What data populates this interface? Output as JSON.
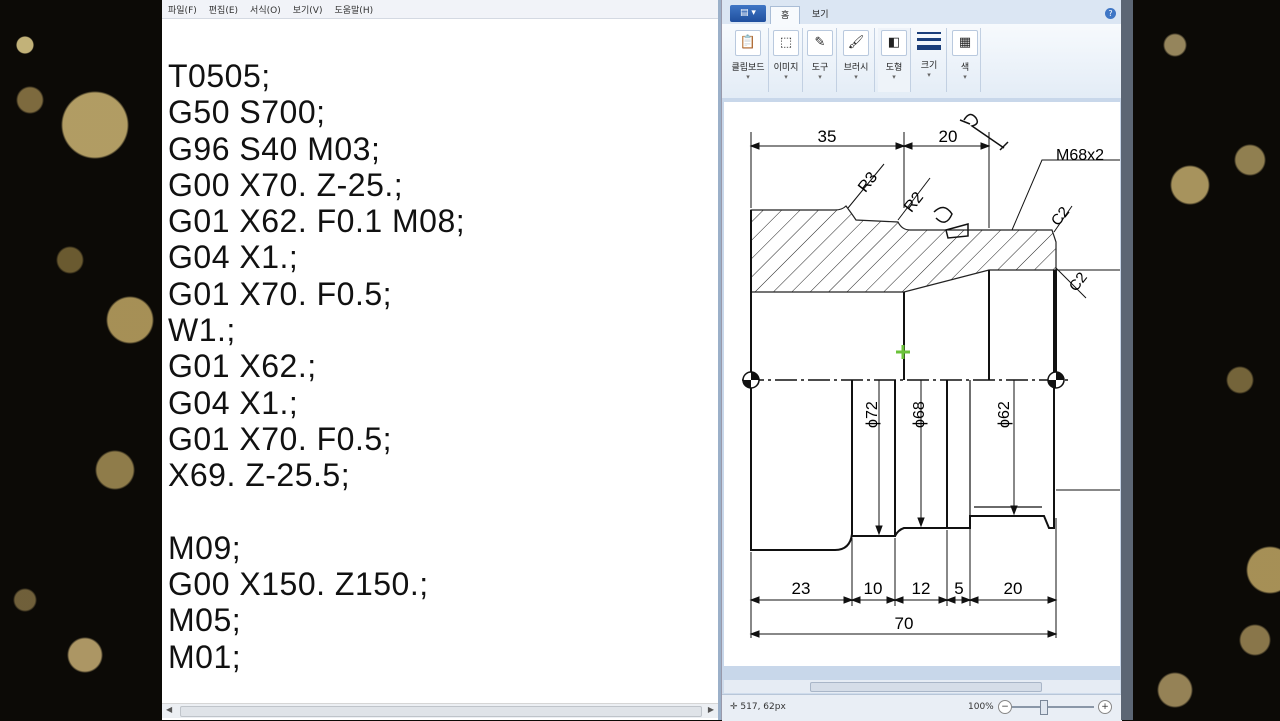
{
  "notepad": {
    "menu": [
      "파일(F)",
      "편집(E)",
      "서식(O)",
      "보기(V)",
      "도움말(H)"
    ],
    "text": "T0505;\nG50 S700;\nG96 S40 M03;\nG00 X70. Z-25.;\nG01 X62. F0.1 M08;\nG04 X1.;\nG01 X70. F0.5;\nW1.;\nG01 X62.;\nG04 X1.;\nG01 X70. F0.5;\nX69. Z-25.5;\n\nM09;\nG00 X150. Z150.;\nM05;\nM01;"
  },
  "paint": {
    "tabs": [
      "홈",
      "보기"
    ],
    "ribbon_groups": [
      "클립보드",
      "이미지",
      "도구",
      "브러시",
      "도형",
      "크기",
      "색"
    ],
    "status_coords": "517, 62px",
    "zoom": "100%"
  },
  "drawing": {
    "dim_top_left": "35",
    "dim_top_right": "20",
    "thread_label": "M68x2",
    "r3": "R3",
    "r2": "R2",
    "c2_top": "C2",
    "c2_right": "C2",
    "d72": "ϕ72",
    "d68": "ϕ68",
    "d62": "ϕ62",
    "bottom_dims": [
      "23",
      "10",
      "12",
      "5",
      "20"
    ],
    "overall": "70"
  }
}
